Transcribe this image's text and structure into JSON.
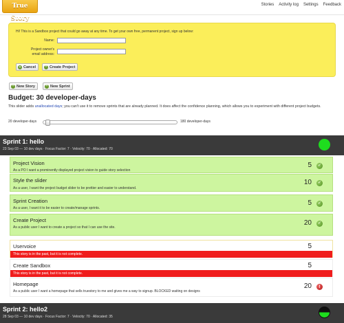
{
  "app": {
    "logo": "True Story",
    "nav": [
      "Stories",
      "Activity log",
      "Settings",
      "Feedback"
    ]
  },
  "notice": {
    "text": "Hi! This is a Sandbox project that could go away at any time. To get your own free, permanent project, sign up below:",
    "name_label": "Name:",
    "name_value": "",
    "email_label_1": "Project owner's",
    "email_label_2": "email address:",
    "email_value": "",
    "cancel_label": "Cancel",
    "create_label": "Create Project"
  },
  "toolbar": {
    "new_story": "New Story",
    "new_sprint": "New Sprint"
  },
  "budget": {
    "title": "Budget: 30 developer-days",
    "desc_1": "This slider adds ",
    "desc_link": "unallocated days",
    "desc_2": "; you can't use it to remove sprints that are already planned. It does affect the confidence planning, which allows you to experiment with different project budgets.",
    "min_label": "20 developer-days",
    "max_label": "180 developer-days",
    "slider_fraction": 0.0
  },
  "sprints": [
    {
      "title": "Sprint 1: hello",
      "meta": "23 Sep 03 — 10 dev days · Focus Factor: 7 · Velocity: 70 · Allocated: 70",
      "status_color": "#1edd1e",
      "stories": [
        {
          "name": "Project Vision",
          "desc": "As a PO I want a prominently displayed project vision to guide story selection",
          "points": "5",
          "status": "check"
        },
        {
          "name": "Style the slider",
          "desc": "As a user, I want the project budget slider to be prettier and easier to understand.",
          "points": "10",
          "status": "check"
        },
        {
          "name": "Sprint Creation",
          "desc": "As a user, I want it to be easier to create/manage sprints.",
          "points": "5",
          "status": "check"
        },
        {
          "name": "Create Project",
          "desc": "As a public user I want to create a project so that I can use the site.",
          "points": "20",
          "status": "check"
        },
        {
          "name": "Uservoice",
          "alert": "This story is in the past, but it is not complete.",
          "points": "5"
        },
        {
          "name": "Create Sandbox",
          "alert": "This story is in the past, but it is not complete.",
          "points": "5"
        },
        {
          "name": "Homepage",
          "desc": "As a public user I want a homepage that sells truestory to me and gives me a way to signup. BLOCKED waiting on designs",
          "points": "20",
          "status": "warn"
        }
      ]
    },
    {
      "title": "Sprint 2: hello2",
      "meta": "28 Sep 03 — 10 dev days · Focus Factor: 7 · Velocity: 70 · Allocated: 35",
      "status_color_top": "#111111",
      "status_color_bottom": "#1edd1e"
    }
  ]
}
